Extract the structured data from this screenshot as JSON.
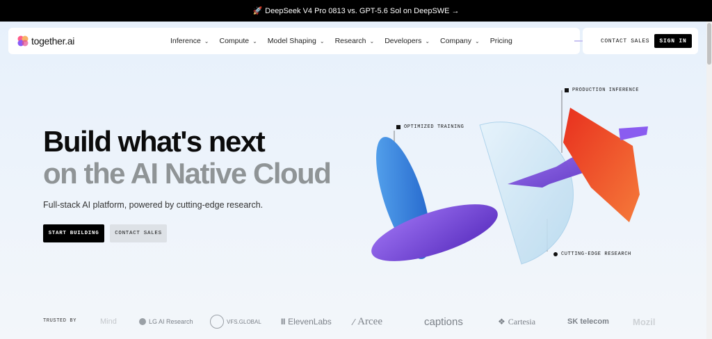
{
  "announcement": {
    "text": "DeepSeek V4 Pro 0813 vs. GPT-5.6 Sol on DeepSWE →",
    "icon": "rocket-icon"
  },
  "nav": {
    "logo_text": "together.ai",
    "items": [
      {
        "label": "Inference",
        "has_dropdown": true
      },
      {
        "label": "Compute",
        "has_dropdown": true
      },
      {
        "label": "Model Shaping",
        "has_dropdown": true
      },
      {
        "label": "Research",
        "has_dropdown": true
      },
      {
        "label": "Developers",
        "has_dropdown": true
      },
      {
        "label": "Company",
        "has_dropdown": true
      },
      {
        "label": "Pricing",
        "has_dropdown": false
      }
    ],
    "contact_sales": "CONTACT SALES",
    "sign_in": "SIGN IN"
  },
  "hero": {
    "title_line1": "Build what's next",
    "title_line2": "on the AI Native Cloud",
    "subtitle": "Full-stack AI platform, powered by cutting-edge research.",
    "start_button": "START BUILDING",
    "contact_button": "CONTACT SALES"
  },
  "illustration": {
    "labels": {
      "production": "PRODUCTION INFERENCE",
      "training": "OPTIMIZED TRAINING",
      "research": "CUTTING-EDGE RESEARCH"
    },
    "colors": {
      "blue": "#3d8fe0",
      "purple": "#7b4fe0",
      "glass": "#c9e4f5",
      "orange": "#f05a28",
      "red": "#e02a20"
    }
  },
  "trusted": {
    "label": "TRUSTED BY",
    "logos": [
      "Mind",
      "LG AI Research",
      "VFS.GLOBAL",
      "ElevenLabs",
      "Arcee",
      "captions",
      "Cartesia",
      "SK telecom",
      "Mozil"
    ]
  }
}
